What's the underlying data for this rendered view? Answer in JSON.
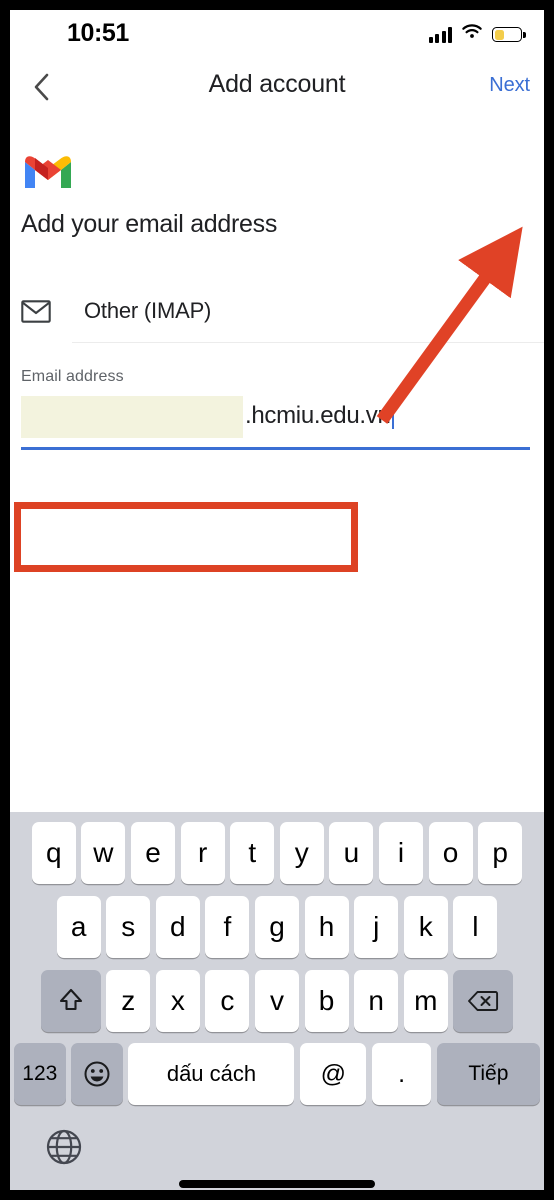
{
  "status_bar": {
    "time": "10:51",
    "icons": [
      "cellular-signal-icon",
      "wifi-icon",
      "battery-icon"
    ],
    "battery_level_pct": 34,
    "battery_color": "#f3cd4b"
  },
  "nav_bar": {
    "back_icon": "chevron-left-icon",
    "title": "Add account",
    "next_label": "Next",
    "next_color": "#3b6fd4"
  },
  "content": {
    "logo": "gmail-logo-icon",
    "headline": "Add your email address",
    "account_type": {
      "icon": "envelope-icon",
      "label": "Other (IMAP)"
    },
    "email_field": {
      "label": "Email address",
      "redacted_prefix": "",
      "visible_value": ".hcmiu.edu.vn",
      "caret_visible": true,
      "underline_color": "#3b6fd4",
      "redaction_color": "#f3f3de"
    }
  },
  "annotations": {
    "highlight_box_color": "#dd4224",
    "arrow_color": "#e04226",
    "arrow_points_to": "Next"
  },
  "keyboard": {
    "language": "Vietnamese",
    "row1": [
      "q",
      "w",
      "e",
      "r",
      "t",
      "y",
      "u",
      "i",
      "o",
      "p"
    ],
    "row2": [
      "a",
      "s",
      "d",
      "f",
      "g",
      "h",
      "j",
      "k",
      "l"
    ],
    "row3_shift_icon": "shift-up-arrow-icon",
    "row3": [
      "z",
      "x",
      "c",
      "v",
      "b",
      "n",
      "m"
    ],
    "row3_backspace_icon": "backspace-delete-icon",
    "row4": {
      "numbers_label": "123",
      "emoji_icon": "emoji-smiley-icon",
      "space_label": "dấu cách",
      "at_label": "@",
      "period_label": ".",
      "return_label": "Tiếp"
    },
    "globe_icon": "globe-language-icon",
    "home_indicator": "home-indicator-bar"
  }
}
